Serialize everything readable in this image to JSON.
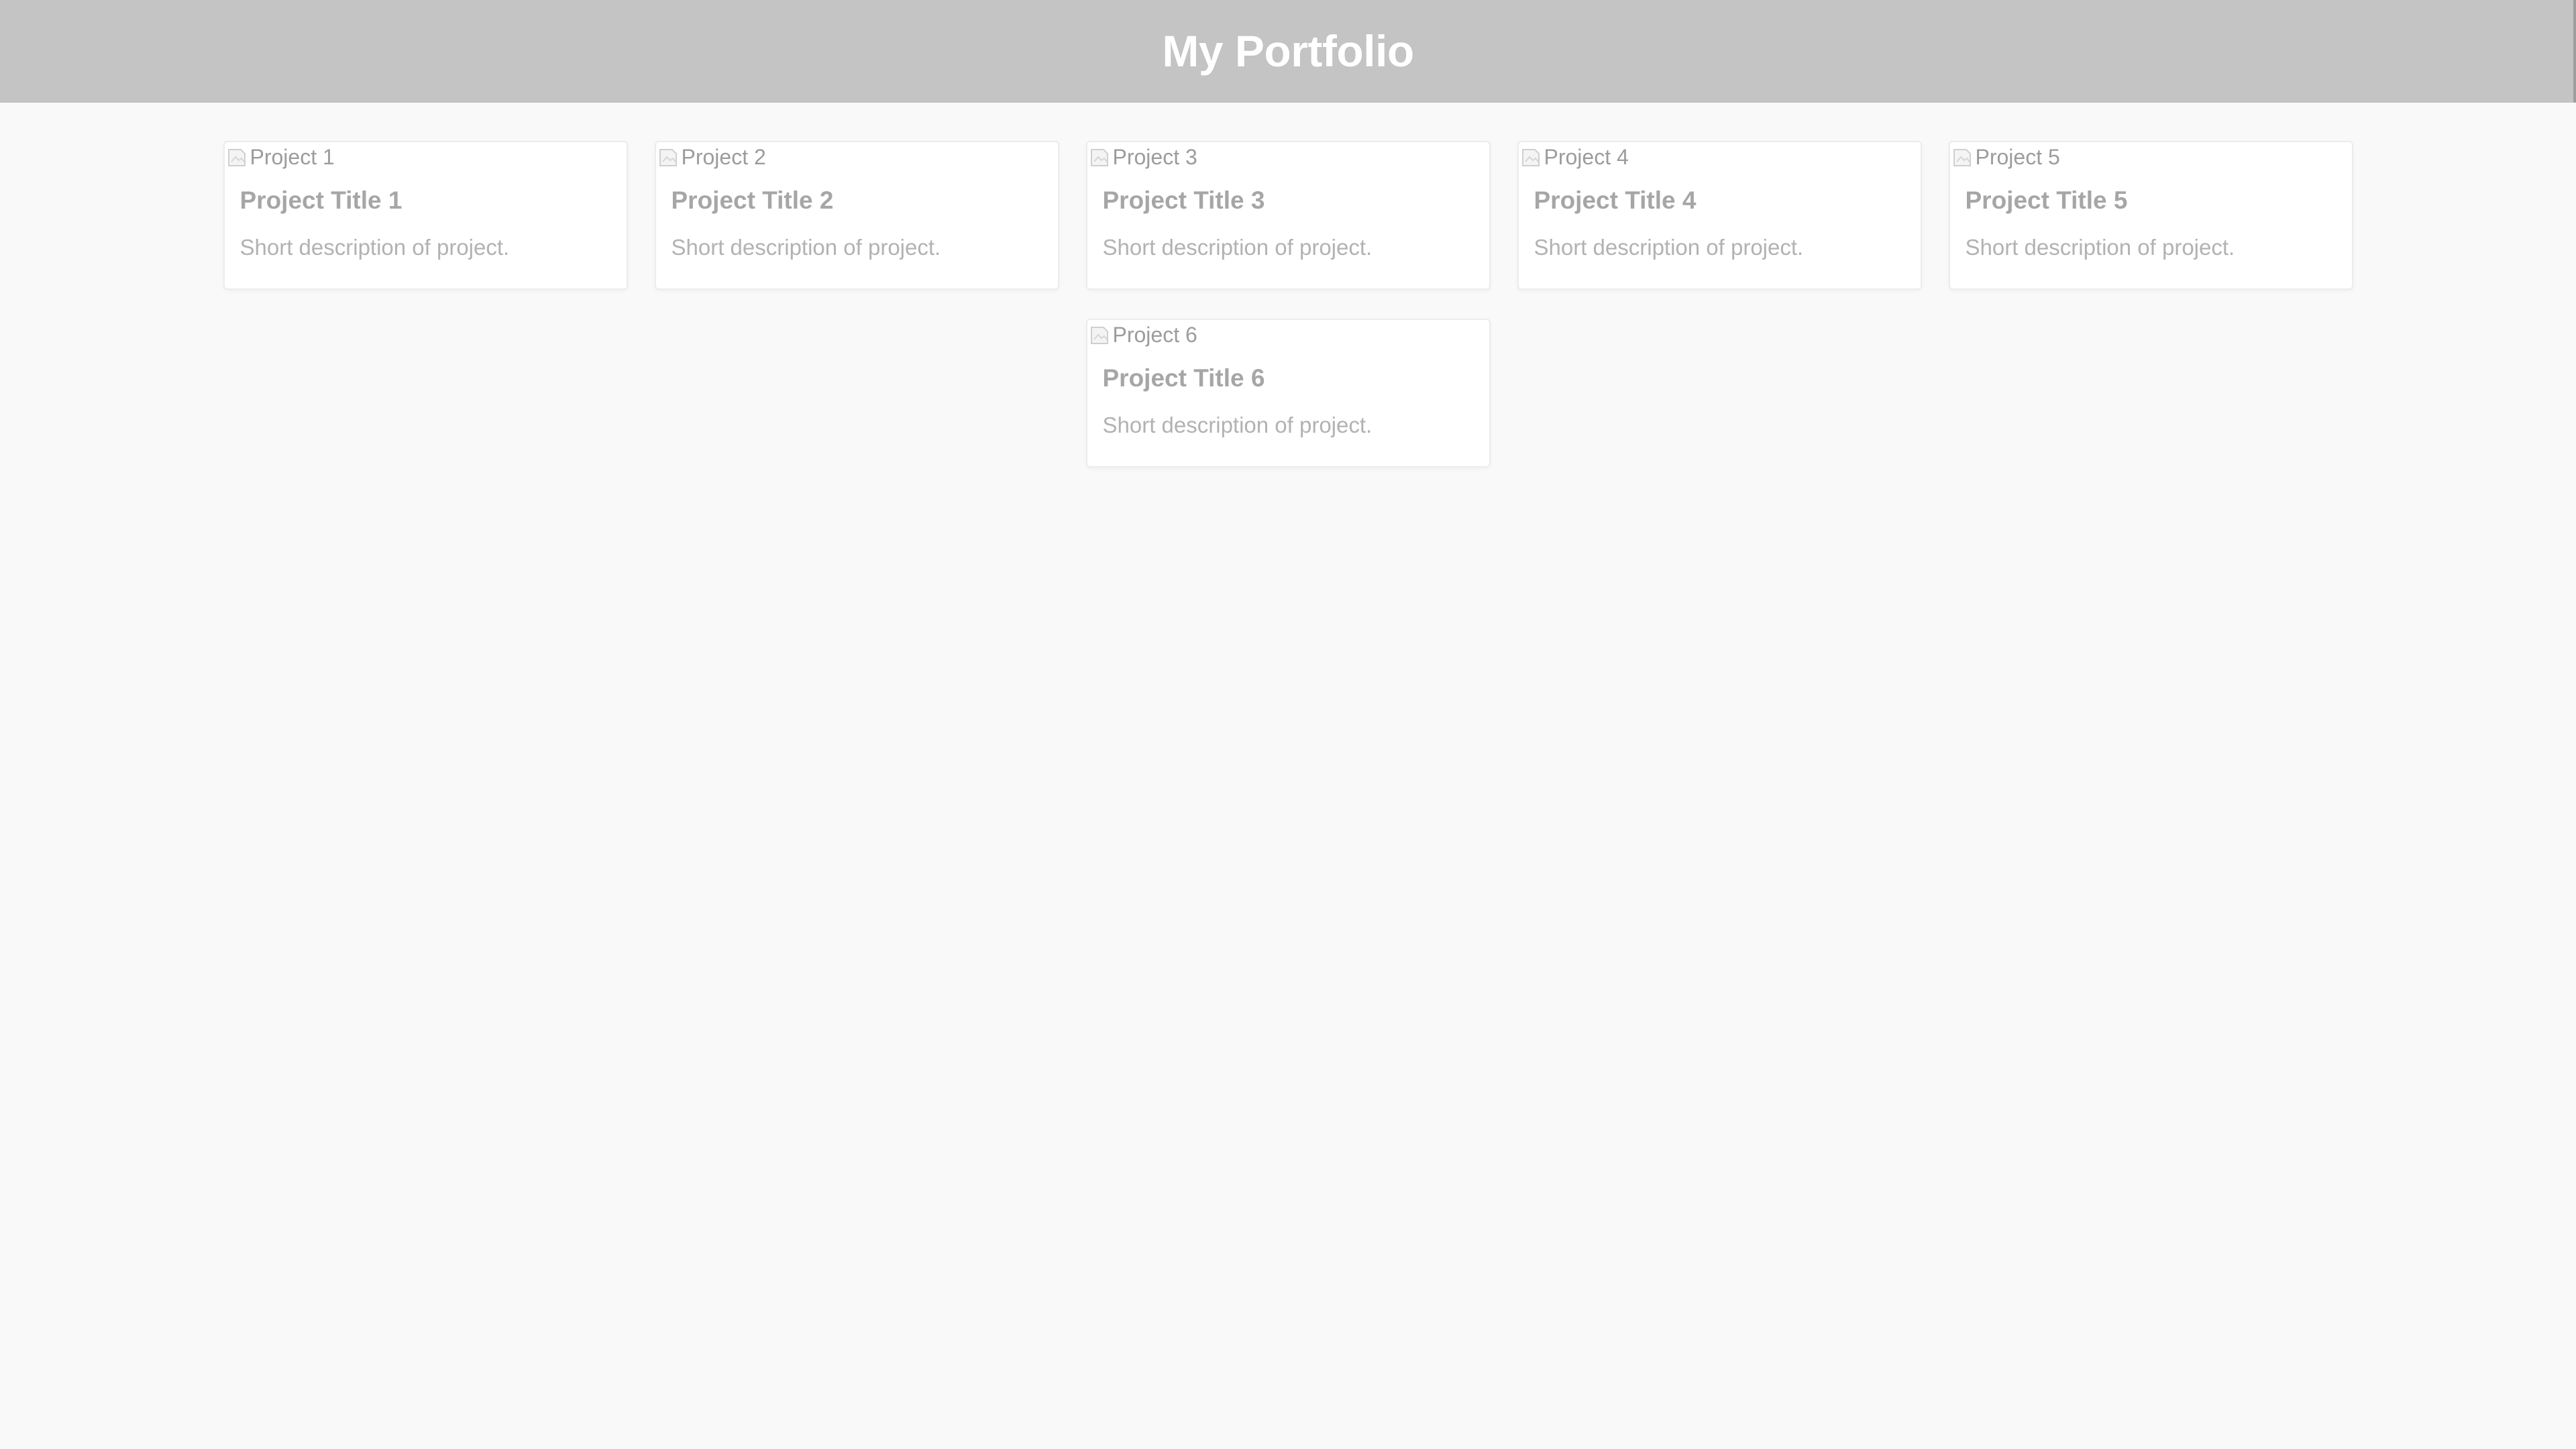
{
  "header": {
    "title": "My Portfolio"
  },
  "projects": [
    {
      "image_alt": "Project 1",
      "title": "Project Title 1",
      "description": "Short description of project."
    },
    {
      "image_alt": "Project 2",
      "title": "Project Title 2",
      "description": "Short description of project."
    },
    {
      "image_alt": "Project 3",
      "title": "Project Title 3",
      "description": "Short description of project."
    },
    {
      "image_alt": "Project 4",
      "title": "Project Title 4",
      "description": "Short description of project."
    },
    {
      "image_alt": "Project 5",
      "title": "Project Title 5",
      "description": "Short description of project."
    },
    {
      "image_alt": "Project 6",
      "title": "Project Title 6",
      "description": "Short description of project."
    }
  ],
  "icons": {
    "image_placeholder": "broken-image-icon"
  },
  "colors": {
    "header_background": "#c4c4c4",
    "header_text": "#ffffff",
    "page_background": "#f9f9f9",
    "card_background": "#ffffff"
  }
}
